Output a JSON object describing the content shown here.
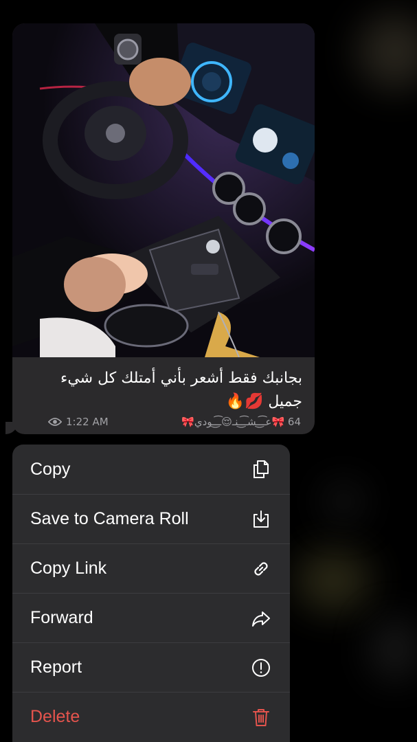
{
  "message": {
    "caption": "بجانبك فقط أشعر بأني أمتلك كل شيء جميل 💋🔥",
    "time": "1:22 AM",
    "reactions": "64 🎀عـ͡ـ͜ـشـ͡ـ͜ـنـ😌ـ͡ـ͜ـودي🎀",
    "views_icon": "eye-icon"
  },
  "menu": {
    "items": [
      {
        "label": "Copy",
        "icon": "copy-icon"
      },
      {
        "label": "Save to Camera Roll",
        "icon": "download-icon"
      },
      {
        "label": "Copy Link",
        "icon": "link-icon"
      },
      {
        "label": "Forward",
        "icon": "forward-icon"
      },
      {
        "label": "Report",
        "icon": "report-icon"
      },
      {
        "label": "Delete",
        "icon": "trash-icon"
      }
    ]
  },
  "colors": {
    "bubble": "#2b2a2c",
    "menu": "#2c2c2e",
    "delete": "#e5544d",
    "meta": "#a2a2a6"
  }
}
